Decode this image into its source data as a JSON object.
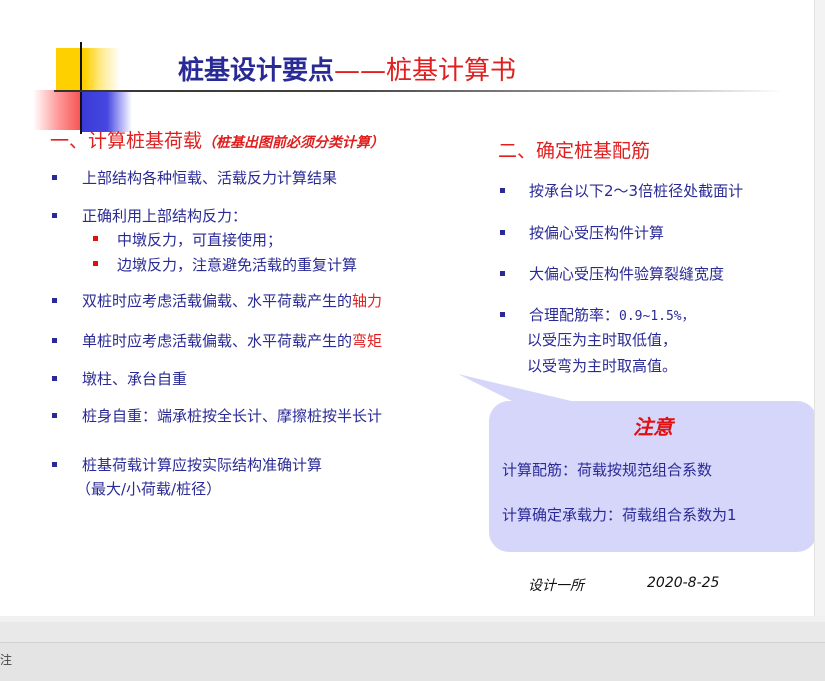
{
  "slide": {
    "title_main": "桩基设计要点",
    "title_sub": "——桩基计算书",
    "section1": {
      "heading": "一、计算桩基荷载",
      "note": "（桩基出图前必须分类计算）",
      "items": [
        "上部结构各种恒载、活载反力计算结果",
        "正确利用上部结构反力：",
        "中墩反力，可直接使用；",
        "边墩反力，注意避免活载的重复计算",
        "双桩时应考虑活载偏载、水平荷载产生的",
        "轴力",
        "单桩时应考虑活载偏载、水平荷载产生的",
        "弯矩",
        "墩柱、承台自重",
        "桩身自重：端承桩按全长计、摩擦桩按半长计",
        "桩基荷载计算应按实际结构准确计算",
        "（最大/小荷载/桩径）"
      ]
    },
    "section2": {
      "heading": "二、确定桩基配筋",
      "items": [
        "按承台以下2～3倍桩径处截面计",
        "按偏心受压构件计算",
        "大偏心受压构件验算裂缝宽度",
        "合理配筋率：",
        "0.9~1.5%，",
        "以受压为主时取低值，",
        "以受弯为主时取高值。"
      ]
    },
    "callout": {
      "title": "注意",
      "lines": [
        "计算配筋：荷载按规范组合系数",
        "计算确定承载力：荷载组合系数为1"
      ]
    },
    "footer": {
      "author": "设计一所",
      "date": "2020-8-25"
    }
  },
  "status_bar": {
    "text": "注"
  }
}
